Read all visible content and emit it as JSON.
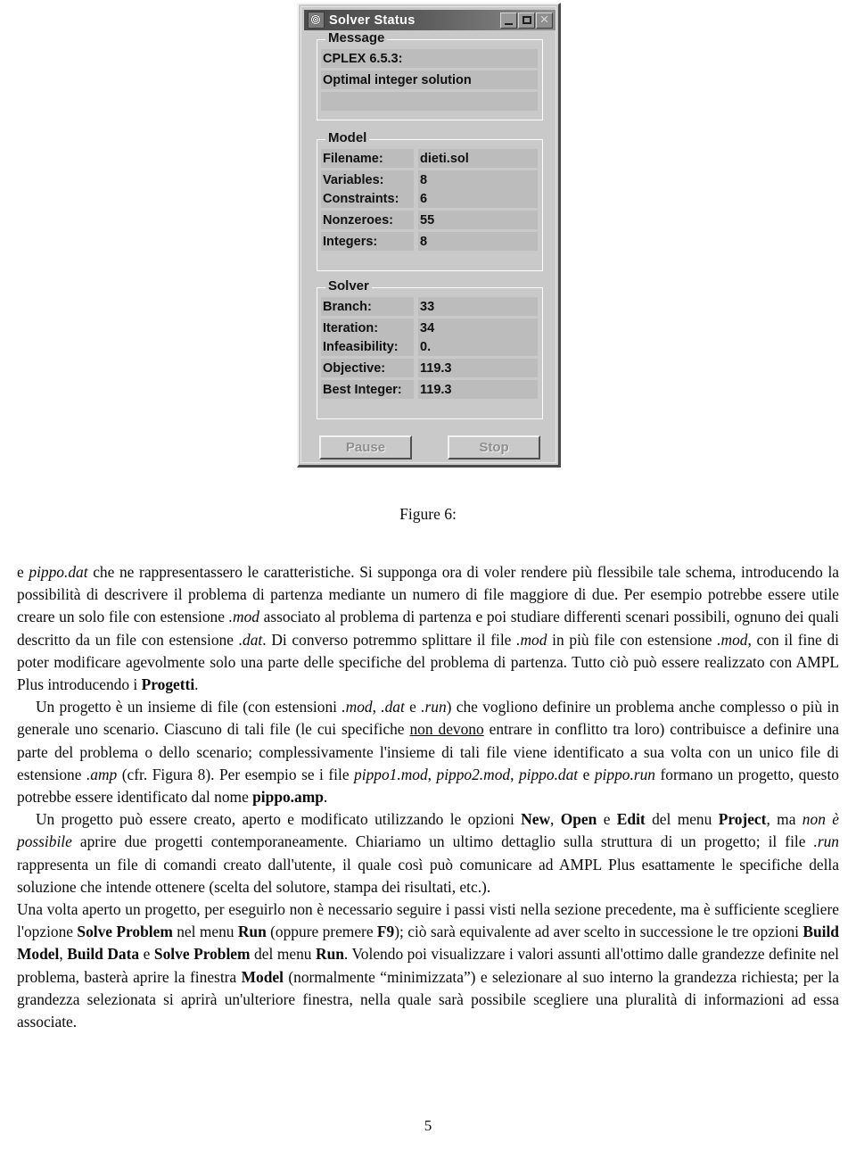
{
  "dialog": {
    "title": "Solver Status",
    "icon": "app-globe-icon",
    "titlebar_buttons": [
      {
        "name": "minimize",
        "glyph": "_"
      },
      {
        "name": "maximize",
        "glyph": "□"
      },
      {
        "name": "close",
        "glyph": "×"
      }
    ],
    "groups": {
      "message": {
        "label": "Message",
        "lines": [
          "CPLEX 6.5.3:",
          "Optimal integer solution",
          ""
        ]
      },
      "model": {
        "label": "Model",
        "rows": [
          {
            "label": "Filename:",
            "value": "dieti.sol"
          },
          {
            "label": "Variables:",
            "value": "8"
          },
          {
            "label": "Constraints:",
            "value": "6"
          },
          {
            "label": "Nonzeroes:",
            "value": "55"
          },
          {
            "label": "Integers:",
            "value": "8"
          }
        ]
      },
      "solver": {
        "label": "Solver",
        "rows": [
          {
            "label": "Branch:",
            "value": "33"
          },
          {
            "label": "Iteration:",
            "value": "34"
          },
          {
            "label": "Infeasibility:",
            "value": "0."
          },
          {
            "label": "Objective:",
            "value": "119.3"
          },
          {
            "label": "Best Integer:",
            "value": "119.3"
          }
        ]
      }
    },
    "buttons": [
      {
        "name": "pause-button",
        "label": "Pause",
        "enabled": false
      },
      {
        "name": "stop-button",
        "label": "Stop",
        "enabled": false
      }
    ]
  },
  "caption": "Figure 6:",
  "page_number": "5",
  "paragraphs": {
    "p1_html": "e <i>pippo.dat</i> che ne rappresentassero le caratteristiche. Si supponga ora di voler rendere più flessibile tale schema, introducendo la possibilità di descrivere il problema di partenza mediante un numero di file maggiore di due. Per esempio potrebbe essere utile creare un solo file con estensione <i>.mod</i> associato al problema di partenza e poi studiare differenti scenari possibili, ognuno dei quali descritto da un file con estensione <i>.dat</i>. Di converso potremmo splittare il file <i>.mod</i> in più file con estensione <i>.mod</i>, con il fine di poter modificare agevolmente solo una parte delle specifiche del problema di partenza. Tutto ciò può essere realizzato con AMPL Plus introducendo i <b>Progetti</b>.",
    "p2_html": "Un progetto è un insieme di file (con estensioni <i>.mod</i>, <i>.dat</i> e <i>.run</i>) che vogliono definire un problema anche complesso o più in generale uno scenario. Ciascuno di tali file (le cui specifiche <u>non devono</u> entrare in conflitto tra loro) contribuisce a definire una parte del problema o dello scenario; complessivamente l'insieme di tali file viene identificato a sua volta con un unico file di estensione <i>.amp</i> (cfr. Figura 8). Per esempio se i file <i>pippo1.mod</i>, <i>pippo2.mod</i>, <i>pippo.dat</i> e <i>pippo.run</i> formano un progetto, questo potrebbe essere identificato dal nome <b>pippo.amp</b>.",
    "p3_html": "Un progetto può essere creato, aperto e modificato utilizzando le opzioni <b>New</b>, <b>Open</b> e <b>Edit</b> del menu <b>Project</b>, ma <i>non è possibile</i> aprire due progetti contemporaneamente. Chiariamo un ultimo dettaglio sulla struttura di un progetto; il file <i>.run</i> rappresenta un file di comandi creato dall'utente, il quale così può comunicare ad AMPL Plus esattamente le specifiche della soluzione che intende ottenere (scelta del solutore, stampa dei risultati, etc.).",
    "p4_html": "Una volta aperto un progetto, per eseguirlo non è necessario seguire i passi visti nella sezione precedente, ma è sufficiente scegliere l'opzione <b>Solve Problem</b> nel menu <b>Run</b> (oppure premere <b>F9</b>); ciò sarà equivalente ad aver scelto in successione le tre opzioni <b>Build Model</b>, <b>Build Data</b> e <b>Solve Problem</b> del menu <b>Run</b>. Volendo poi visualizzare i valori assunti all'ottimo dalle grandezze definite nel problema, basterà aprire la finestra <b>Model</b> (normalmente “minimizzata”) e selezionare al suo interno la grandezza richiesta; per la grandezza selezionata si aprirà un'ulteriore finestra, nella quale sarà possibile scegliere una pluralità di informazioni ad essa associate."
  },
  "colors": {
    "dialog_face": "#c9c9c9",
    "field_bg": "#bcbcbc",
    "titlebar_dark": "#4b4b4b",
    "titlebar_light": "#8d8d8d",
    "text": "#101010"
  }
}
